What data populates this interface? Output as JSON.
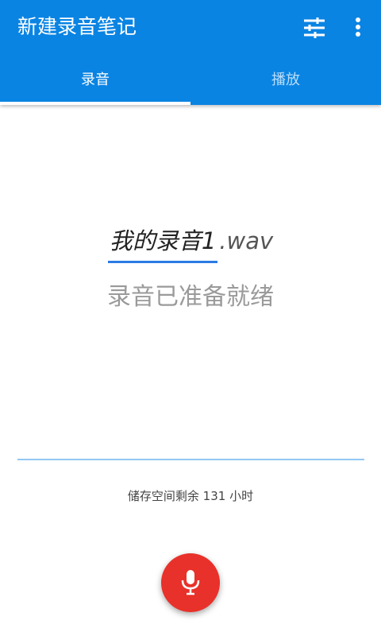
{
  "toolbar": {
    "title": "新建录音笔记",
    "tune_icon": "tune-sliders-icon",
    "more_icon": "more-vert-icon"
  },
  "tabs": [
    {
      "label": "录音",
      "selected": true
    },
    {
      "label": "播放",
      "selected": false
    }
  ],
  "recording": {
    "filename_name": "我的录音1",
    "filename_ext": ".wav",
    "status": "录音已准备就绪",
    "storage_text": "储存空间剩余 131 小时"
  },
  "fab": {
    "icon": "microphone-icon"
  },
  "colors": {
    "app_bar": "#0a84e3",
    "accent": "#2c7be5",
    "fab": "#e8312a",
    "progress_line": "#93c7f4"
  }
}
